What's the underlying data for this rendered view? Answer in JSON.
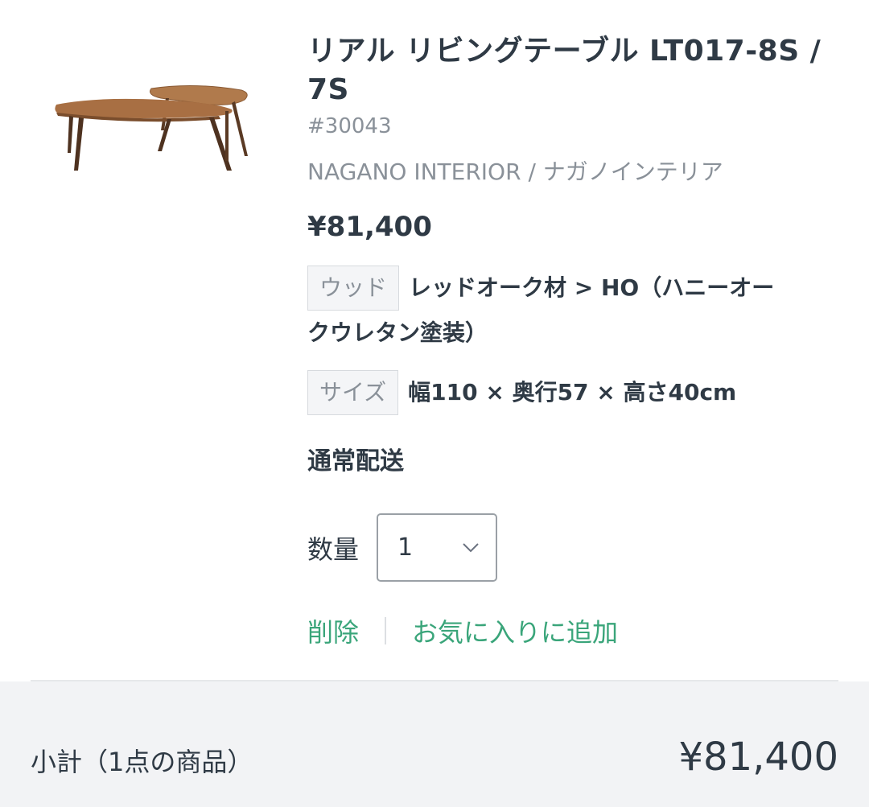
{
  "product": {
    "title": "リアル リビングテーブル LT017-8S / 7S",
    "sku": "#30043",
    "brand": "NAGANO INTERIOR / ナガノインテリア",
    "price": "¥81,400",
    "image_icon": "coffee-table-image"
  },
  "options": [
    {
      "label": "ウッド",
      "value_line1": "レッドオーク材 > HO（ハニーオー",
      "value_line2": "クウレタン塗装）"
    },
    {
      "label": "サイズ",
      "value": "幅110 × 奥行57 × 高さ40cm"
    }
  ],
  "shipping": "通常配送",
  "quantity": {
    "label": "数量",
    "value": "1"
  },
  "actions": {
    "delete": "削除",
    "favorite": "お気に入りに追加"
  },
  "summary": {
    "label": "小計（1点の商品）",
    "price": "¥81,400"
  },
  "colors": {
    "accent": "#3aa57a",
    "text": "#2f3a45",
    "muted": "#8a9199",
    "summary_bg": "#f2f3f5"
  }
}
